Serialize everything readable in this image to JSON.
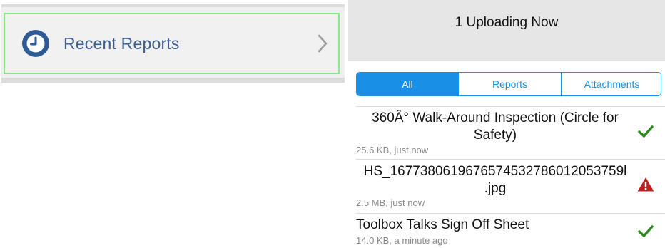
{
  "recent_reports": {
    "label": "Recent Reports",
    "icon": "clock-icon",
    "chevron_icon": "chevron-right-icon",
    "accent_color": "#2e5a96"
  },
  "upload_header": {
    "title": "1 Uploading Now"
  },
  "filter_tabs": [
    {
      "label": "All",
      "active": true
    },
    {
      "label": "Reports",
      "active": false
    },
    {
      "label": "Attachments",
      "active": false
    }
  ],
  "uploads": [
    {
      "title_line1": "360Â° Walk-Around Inspection (Circle for",
      "title_line2": "Safety)",
      "meta": "25.6 KB, just now",
      "status": "success",
      "status_icon": "check-icon",
      "status_color": "#2e8b1e"
    },
    {
      "title_line1": "HS_1677380619676574532786012053759l",
      "title_line2": ".jpg",
      "meta": "2.5 MB, just now",
      "status": "error",
      "status_icon": "warning-icon",
      "status_color": "#c0201c"
    },
    {
      "title_line1": "Toolbox Talks Sign Off Sheet",
      "meta": "14.0 KB, a minute ago",
      "status": "success",
      "status_icon": "check-icon",
      "status_color": "#2e8b1e"
    }
  ]
}
